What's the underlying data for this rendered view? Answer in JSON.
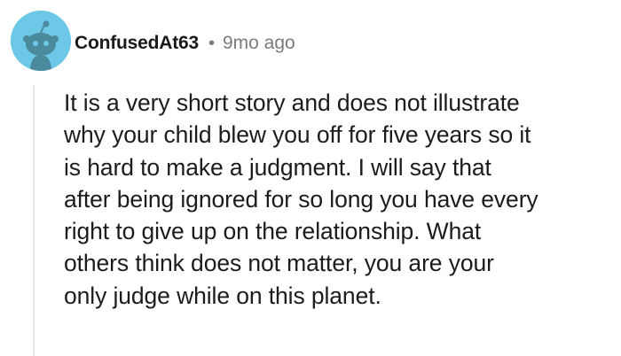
{
  "comment": {
    "author": "ConfusedAt63",
    "separator": "•",
    "timestamp": "9mo ago",
    "avatar_icon": "snoo-avatar-icon",
    "avatar_color": "#6cc8e6",
    "body_lines": [
      "It is a very short story and does not illustrate",
      "why your child blew you off for five years so it",
      "is hard to make a judgment. I will say that",
      "after being ignored for so long you have every",
      "right to give up on the relationship. What",
      "others think does not matter, you are your",
      "only judge while on this planet."
    ]
  }
}
